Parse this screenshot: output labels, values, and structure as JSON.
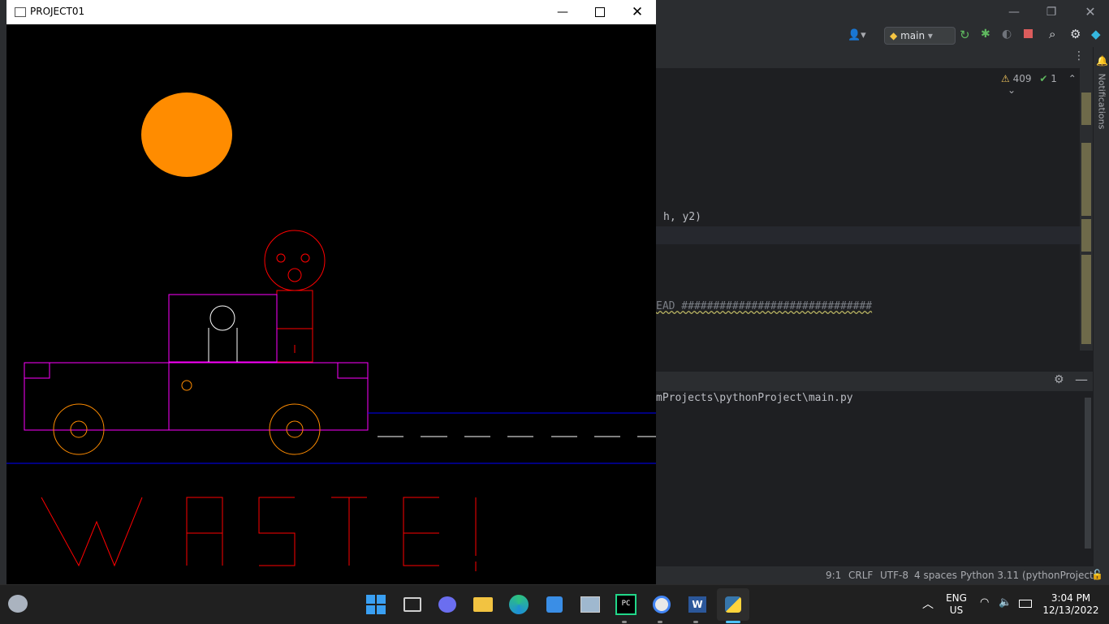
{
  "project_window": {
    "title": "PROJECT01",
    "canvas_text": "WASTE!"
  },
  "ide": {
    "branch": "main",
    "inspections": {
      "warnings": "409",
      "ok": "1"
    },
    "notifications_label": "Notifications",
    "code_lines": [
      {
        "text": "h, y2)"
      },
      {
        "text": "EAD ##############################"
      }
    ],
    "run_path": "mProjects\\pythonProject\\main.py",
    "status": {
      "position": "9:1",
      "line_sep": "CRLF",
      "encoding": "UTF-8",
      "indent": "4 spaces",
      "interpreter": "Python 3.11 (pythonProject)"
    }
  },
  "taskbar": {
    "lang_line1": "ENG",
    "lang_line2": "US",
    "time": "3:04 PM",
    "date": "12/13/2022"
  },
  "colors": {
    "sun": "#ff8c00",
    "truck": "#ff00ff",
    "person": "#ff0000",
    "wheels": "#ff8c00",
    "road": "#0000ff"
  }
}
